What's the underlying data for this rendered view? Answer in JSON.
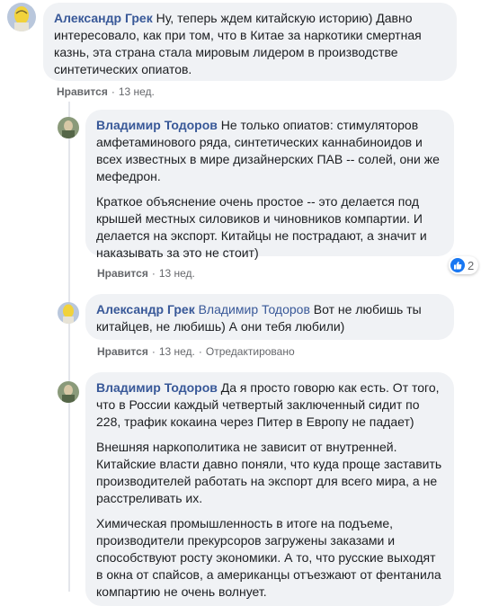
{
  "comments": [
    {
      "author": "Александр Грек",
      "mention": "",
      "paragraphs": [
        "Ну, теперь ждем китайскую историю) Давно интересовало, как при том, что в Китае за наркотики смертная казнь, эта страна стала мировым лидером в производстве синтетических опиатов."
      ],
      "like_label": "Нравится",
      "time": "13 нед.",
      "edited": ""
    },
    {
      "author": "Владимир Тодоров",
      "mention": "",
      "paragraphs": [
        "Не только опиатов: стимуляторов амфетаминового ряда, синтетических каннабиноидов и всех известных в мире дизайнерских ПАВ -- солей, они же мефедрон.",
        "Краткое объяснение очень простое -- это делается под крышей местных силовиков и чиновников компартии. И делается на экспорт. Китайцы не пострадают, а значит и наказывать за это не стоит)"
      ],
      "like_label": "Нравится",
      "time": "13 нед.",
      "edited": "",
      "reaction_count": "2"
    },
    {
      "author": "Александр Грек",
      "mention": "Владимир Тодоров",
      "paragraphs": [
        "Вот не любишь ты китайцев, не любишь) А они тебя любили)"
      ],
      "like_label": "Нравится",
      "time": "13 нед.",
      "edited": "Отредактировано"
    },
    {
      "author": "Владимир Тодоров",
      "mention": "",
      "paragraphs": [
        "Да я просто говорю как есть. От того, что в России каждый четвертый заключенный сидит по 228, трафик кокаина через Питер в Европу не падает)",
        "Внешняя наркополитика не зависит от внутренней. Китайские власти давно поняли, что куда проще заставить производителей работать на экспорт для всего мира, а не расстреливать их.",
        "Химическая промышленность в итоге на подъеме, производители прекурсоров загружены заказами и способствуют росту экономики. А то, что русские выходят в окна от спайсов, а американцы отъезжают от фентанила компартию не очень волнует."
      ]
    }
  ],
  "colors": {
    "bubble": "#f0f2f5",
    "author": "#385898",
    "meta": "#65676b",
    "like_icon": "#1877f2"
  }
}
